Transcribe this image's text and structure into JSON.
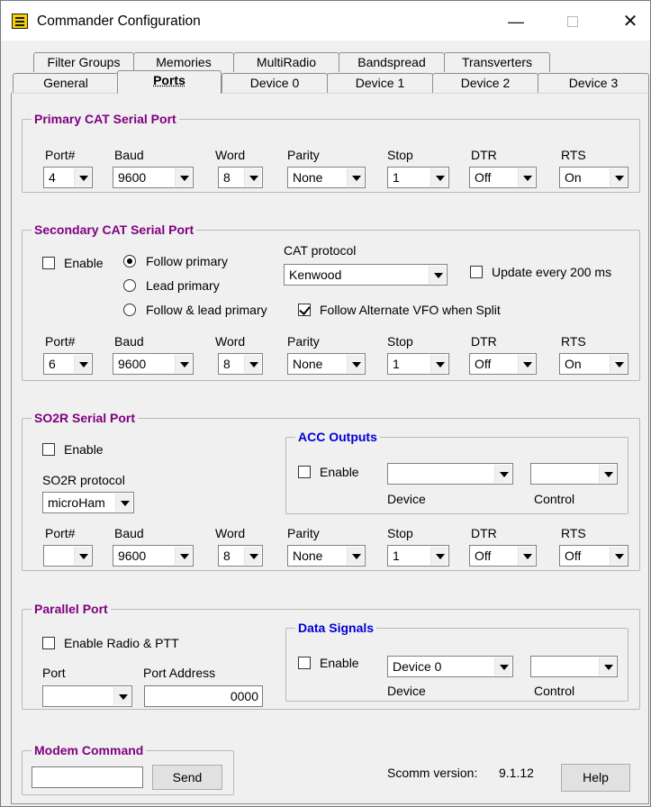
{
  "window": {
    "title": "Commander Configuration",
    "min": "—",
    "close": "✕"
  },
  "tabs_row1": [
    "Filter Groups",
    "Memories",
    "MultiRadio",
    "Bandspread",
    "Transverters"
  ],
  "tabs_row2": [
    "General",
    "Ports",
    "Device 0",
    "Device 1",
    "Device 2",
    "Device 3"
  ],
  "selected_tab": "Ports",
  "port_headers": {
    "port": "Port#",
    "baud": "Baud",
    "word": "Word",
    "parity": "Parity",
    "stop": "Stop",
    "dtr": "DTR",
    "rts": "RTS"
  },
  "primary": {
    "title": "Primary CAT Serial Port",
    "port": "4",
    "baud": "9600",
    "word": "8",
    "parity": "None",
    "stop": "1",
    "dtr": "Off",
    "rts": "On"
  },
  "secondary": {
    "title": "Secondary CAT Serial Port",
    "enable_label": "Enable",
    "enable_checked": false,
    "radios": [
      {
        "label": "Follow primary",
        "checked": true
      },
      {
        "label": "Lead primary",
        "checked": false
      },
      {
        "label": "Follow & lead primary",
        "checked": false
      }
    ],
    "protocol_label": "CAT protocol",
    "protocol": "Kenwood",
    "update_label": "Update every 200 ms",
    "update_checked": false,
    "follow_vfo_label": "Follow Alternate VFO when Split",
    "follow_vfo_checked": true,
    "port": "6",
    "baud": "9600",
    "word": "8",
    "parity": "None",
    "stop": "1",
    "dtr": "Off",
    "rts": "On"
  },
  "so2r": {
    "title": "SO2R Serial Port",
    "enable_label": "Enable",
    "enable_checked": false,
    "protocol_label": "SO2R protocol",
    "protocol": "microHam",
    "acc": {
      "title": "ACC Outputs",
      "enable_label": "Enable",
      "enable_checked": false,
      "device": "",
      "control": "",
      "device_label": "Device",
      "control_label": "Control"
    },
    "port": "",
    "baud": "9600",
    "word": "8",
    "parity": "None",
    "stop": "1",
    "dtr": "Off",
    "rts": "Off"
  },
  "parallel": {
    "title": "Parallel Port",
    "enable_label": "Enable Radio & PTT",
    "enable_checked": false,
    "port_label": "Port",
    "port": "",
    "address_label": "Port Address",
    "address": "0000",
    "data": {
      "title": "Data Signals",
      "enable_label": "Enable",
      "enable_checked": false,
      "device": "Device 0",
      "control": "",
      "device_label": "Device",
      "control_label": "Control"
    }
  },
  "modem": {
    "title": "Modem Command",
    "value": "",
    "send": "Send"
  },
  "version": {
    "label": "Scomm version:",
    "value": "9.1.12"
  },
  "help": "Help"
}
